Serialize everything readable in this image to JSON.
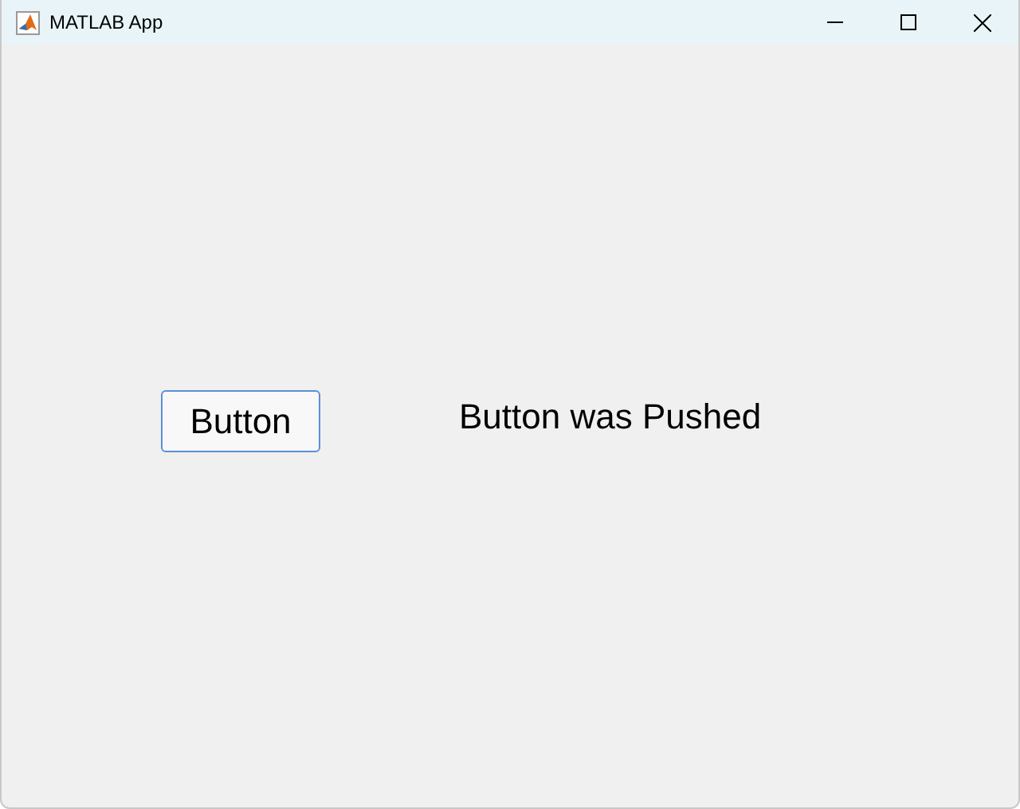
{
  "window": {
    "title": "MATLAB App"
  },
  "button": {
    "label": "Button"
  },
  "label": {
    "text": "Button was Pushed"
  }
}
